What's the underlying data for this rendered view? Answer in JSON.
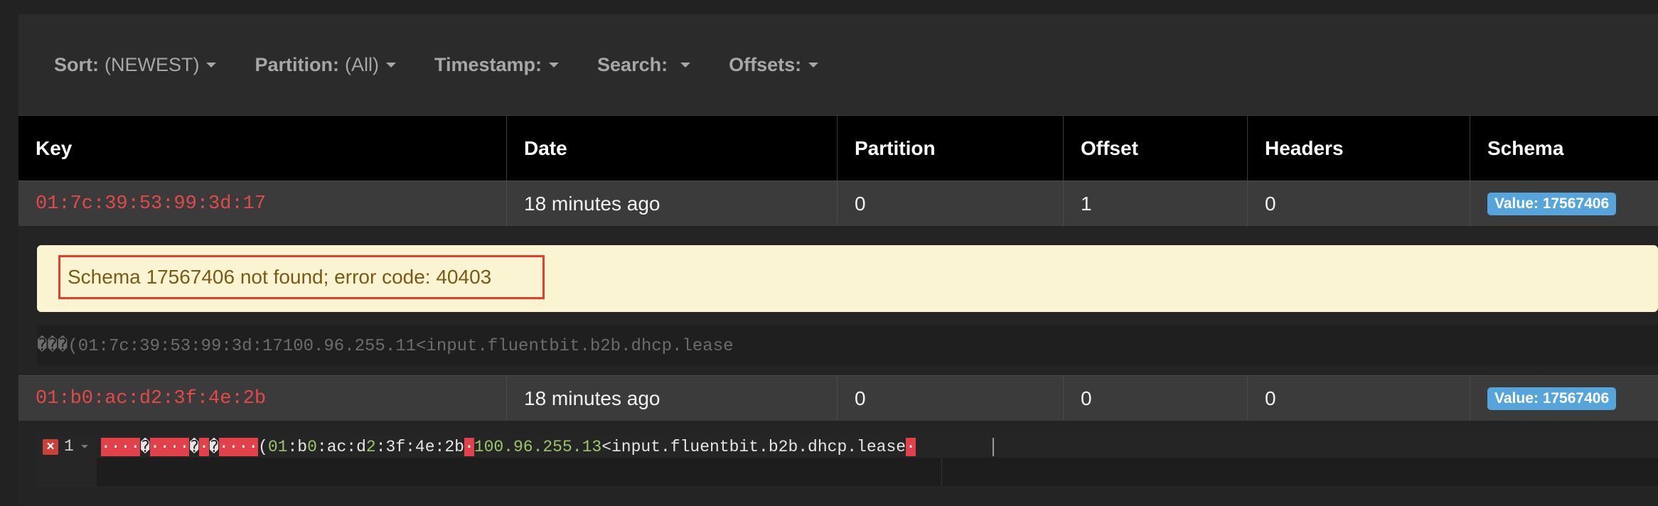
{
  "toolbar": {
    "sort": {
      "label": "Sort:",
      "value": "(NEWEST)"
    },
    "partition": {
      "label": "Partition:",
      "value": "(All)"
    },
    "timestamp": {
      "label": "Timestamp:"
    },
    "search": {
      "label": "Search:"
    },
    "offsets": {
      "label": "Offsets:"
    }
  },
  "table": {
    "headers": [
      "Key",
      "Date",
      "Partition",
      "Offset",
      "Headers",
      "Schema"
    ],
    "rows": [
      {
        "key": "01:7c:39:53:99:3d:17",
        "date": "18 minutes ago",
        "partition": "0",
        "offset": "1",
        "headers": "0",
        "schema": "Value: 17567406"
      },
      {
        "key": "01:b0:ac:d2:3f:4e:2b",
        "date": "18 minutes ago",
        "partition": "0",
        "offset": "0",
        "headers": "0",
        "schema": "Value: 17567406"
      }
    ]
  },
  "row1_detail": {
    "error": "Schema 17567406 not found; error code: 40403",
    "raw": "���(01:7c:39:53:99:3d:17100.96.255.11<input.fluentbit.b2b.dhcp.lease"
  },
  "row2_detail": {
    "line_number": "1",
    "error_icon": "close-icon",
    "segments": {
      "ctrl1": "····",
      "q1": "�",
      "ctrl2": "····",
      "q2": "�",
      "ctrl3": "·",
      "q3": "�",
      "ctrl4": "····",
      "paren": "(",
      "n01": "01",
      "t1": ":b",
      "n0": "0",
      "t2": ":ac:d",
      "n2": "2",
      "t3": ":3f:4e:2b",
      "ctrl5": "·",
      "ip": "100.96.255.13",
      "t4": "<input.fluentbit.b2b.dhcp.lease",
      "ctrl6": "·"
    }
  },
  "colors": {
    "key_red": "#e24a4a",
    "badge_blue": "#56a4dc",
    "alert_bg": "#fbf4d3",
    "highlight_border": "#e53e2d"
  }
}
